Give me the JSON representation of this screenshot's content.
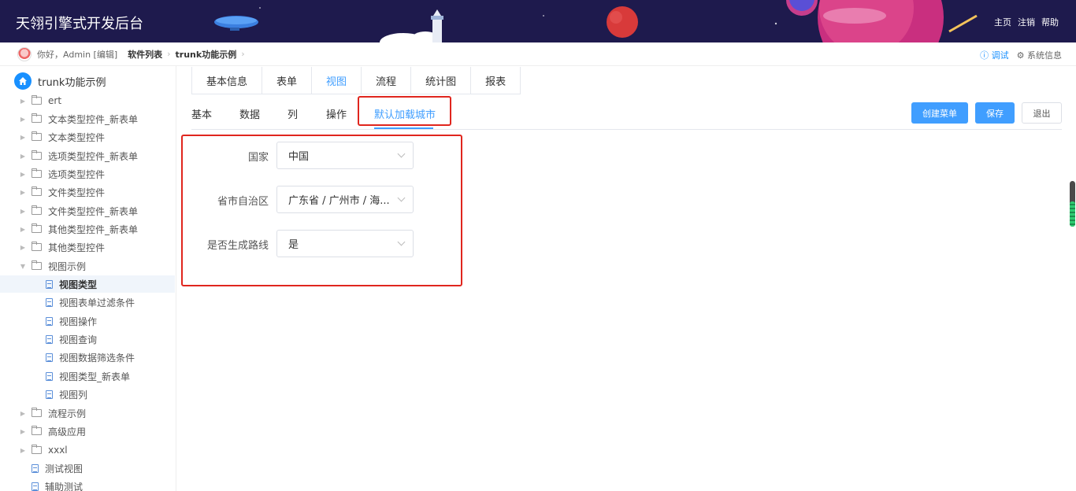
{
  "header": {
    "title": "天翎引擎式开发后台",
    "nav": [
      "主页",
      "注销",
      "帮助"
    ]
  },
  "crumb": {
    "greeting": "你好，Admin [编辑]",
    "items": [
      "软件列表",
      "trunk功能示例"
    ],
    "debug": "调试",
    "sysinfo": "系统信息"
  },
  "sidebar": {
    "root": "trunk功能示例",
    "items": [
      {
        "label": "ert",
        "type": "folder"
      },
      {
        "label": "文本类型控件_新表单",
        "type": "folder"
      },
      {
        "label": "文本类型控件",
        "type": "folder"
      },
      {
        "label": "选项类型控件_新表单",
        "type": "folder"
      },
      {
        "label": "选项类型控件",
        "type": "folder"
      },
      {
        "label": "文件类型控件",
        "type": "folder"
      },
      {
        "label": "文件类型控件_新表单",
        "type": "folder"
      },
      {
        "label": "其他类型控件_新表单",
        "type": "folder"
      },
      {
        "label": "其他类型控件",
        "type": "folder"
      },
      {
        "label": "视图示例",
        "type": "folder-open"
      },
      {
        "label": "视图类型",
        "type": "doc",
        "active": true
      },
      {
        "label": "视图表单过滤条件",
        "type": "doc"
      },
      {
        "label": "视图操作",
        "type": "doc"
      },
      {
        "label": "视图查询",
        "type": "doc"
      },
      {
        "label": "视图数据筛选条件",
        "type": "doc"
      },
      {
        "label": "视图类型_新表单",
        "type": "doc"
      },
      {
        "label": "视图列",
        "type": "doc"
      },
      {
        "label": "流程示例",
        "type": "folder"
      },
      {
        "label": "高级应用",
        "type": "folder"
      },
      {
        "label": "xxxl",
        "type": "folder"
      },
      {
        "label": "测试视图",
        "type": "doc-root"
      },
      {
        "label": "辅助测试",
        "type": "doc-root"
      }
    ]
  },
  "tabs_top": [
    "基本信息",
    "表单",
    "视图",
    "流程",
    "统计图",
    "报表"
  ],
  "tabs_sub": [
    "基本",
    "数据",
    "列",
    "操作",
    "默认加载城市"
  ],
  "buttons": {
    "create_menu": "创建菜单",
    "save": "保存",
    "exit": "退出"
  },
  "form": {
    "country_label": "国家",
    "country_value": "中国",
    "province_label": "省市自治区",
    "province_value": "广东省 / 广州市 / 海...",
    "route_label": "是否生成路线",
    "route_value": "是"
  },
  "colors": {
    "accent": "#409eff",
    "highlight": "#e0261e",
    "header_bg": "#1e1a4d"
  }
}
